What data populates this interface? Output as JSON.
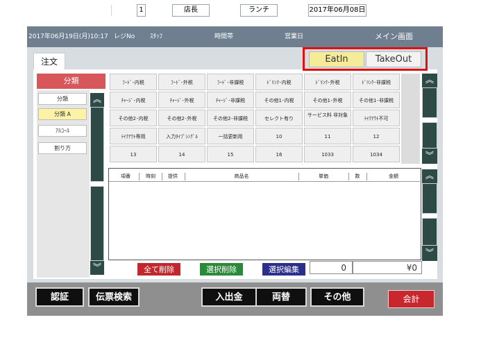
{
  "topbar": {
    "datetime": "2017年06月19日(月)10:17",
    "register_label": "レジNo",
    "register_no": "1",
    "staff_label": "ｽﾀｯﾌ",
    "staff_value": "店長",
    "period_label": "時間帯",
    "period_value": "ランチ",
    "business_day_label": "営業日",
    "business_day_value": "2017年06月08日",
    "screen_title": "メイン画面"
  },
  "tabs": {
    "order_tab": "注文"
  },
  "mode_buttons": {
    "eatin": "EatIn",
    "takeout": "TakeOut",
    "highlight_color": "#e01010"
  },
  "category": {
    "header": "分類",
    "items": [
      {
        "label": "分類",
        "selected": false
      },
      {
        "label": "分類 A",
        "selected": true
      },
      {
        "label": "ｱﾙｺｰﾙ",
        "selected": false
      },
      {
        "label": "割り方",
        "selected": false
      }
    ]
  },
  "products": {
    "rows": [
      [
        "ﾌｰﾄﾞ･内税",
        "ﾌｰﾄﾞ･外税",
        "ﾌｰﾄﾞ･非課税",
        "ﾄﾞﾘﾝｸ･内税",
        "ﾄﾞﾘﾝｸ･外税",
        "ﾄﾞﾘﾝｸ･非課税"
      ],
      [
        "ﾁｬｰｼﾞ･内税",
        "ﾁｬｰｼﾞ･外税",
        "ﾁｬｰｼﾞ･非課税",
        "その他1･内税",
        "その他1･外税",
        "その他1･非課税"
      ],
      [
        "その他2･内税",
        "その他2･外税",
        "その他2･非課税",
        "セレクト有り",
        "サービス料 非対象",
        "ﾃｲｸｱｳﾄ不可"
      ],
      [
        "ﾃｲｸｱｳﾄ専用",
        "入力ﾀｲﾌﾟｼﾝｸﾞﾙ",
        "一括更新用",
        "10",
        "11",
        "12"
      ],
      [
        "13",
        "14",
        "15",
        "16",
        "1033",
        "1034"
      ]
    ]
  },
  "order_table": {
    "headers": [
      "項番",
      "時刻",
      "提供",
      "商品名",
      "単価",
      "数",
      "金額"
    ]
  },
  "actions": {
    "delete_all": "全て削除",
    "delete_selected": "選択削除",
    "edit_selected": "選択編集"
  },
  "totals": {
    "quantity": "0",
    "amount": "¥0"
  },
  "bottom": {
    "auth": "認証",
    "slip_search": "伝票検索",
    "cash_in_out": "入出金",
    "exchange": "両替",
    "other": "その他",
    "checkout": "会計"
  },
  "colors": {
    "topbar": "#6f7f90",
    "category_header": "#d8575a",
    "selected_category": "#fcf3a6",
    "eatin_bg": "#f5ec9a",
    "scroll_dark": "#2e4a46",
    "delete_all": "#c1272d",
    "delete_selected": "#2a8a3a",
    "edit_selected": "#2b2e8a",
    "checkout": "#c8272e"
  }
}
